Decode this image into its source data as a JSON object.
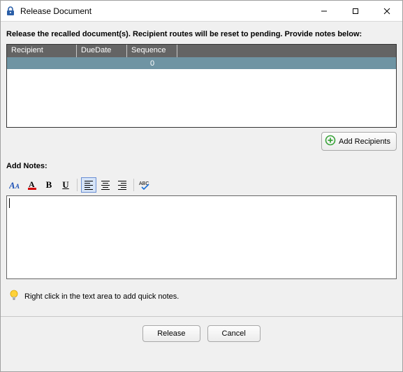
{
  "window": {
    "title": "Release Document"
  },
  "instruction": "Release the recalled document(s). Recipient routes will be reset to pending. Provide notes below:",
  "table": {
    "headers": {
      "recipient": "Recipient",
      "dueDate": "DueDate",
      "sequence": "Sequence"
    },
    "rows": [
      {
        "recipient": "",
        "dueDate": "",
        "sequence": "0"
      }
    ]
  },
  "buttons": {
    "addRecipients": "Add Recipients",
    "release": "Release",
    "cancel": "Cancel"
  },
  "notes": {
    "label": "Add Notes:",
    "content": ""
  },
  "hint": "Right click in the text area to add quick notes.",
  "toolbar": {
    "bold": "B",
    "underline": "U"
  }
}
